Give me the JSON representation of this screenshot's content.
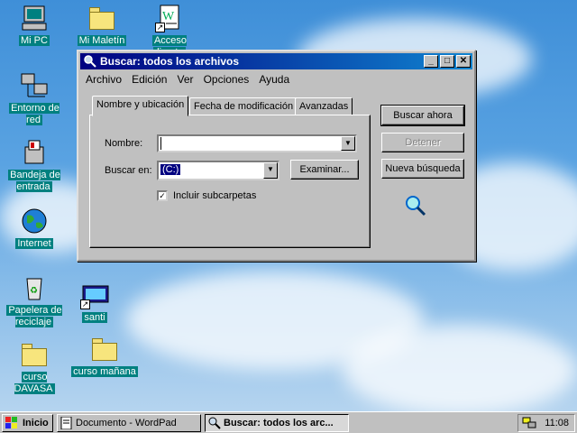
{
  "desktop": {
    "icons": [
      {
        "label": "Mi PC",
        "icon": "computer-icon"
      },
      {
        "label": "Mi Maletín",
        "icon": "briefcase-folder-icon"
      },
      {
        "label": "Acceso directo",
        "icon": "wordpad-shortcut-icon"
      },
      {
        "label": "Entorno de red",
        "icon": "network-icon"
      },
      {
        "label": "Bandeja de entrada",
        "icon": "inbox-icon"
      },
      {
        "label": "Internet",
        "icon": "internet-globe-icon"
      },
      {
        "label": "Papelera de reciclaje",
        "icon": "recycle-bin-icon"
      },
      {
        "label": "santi",
        "icon": "calculator-shortcut-icon"
      },
      {
        "label": "curso DAVASA",
        "icon": "folder-icon"
      },
      {
        "label": "curso mañana",
        "icon": "folder-icon"
      }
    ]
  },
  "window": {
    "title": "Buscar: todos los archivos",
    "menu": [
      "Archivo",
      "Edición",
      "Ver",
      "Opciones",
      "Ayuda"
    ],
    "tabs": [
      "Nombre y ubicación",
      "Fecha de modificación",
      "Avanzadas"
    ],
    "active_tab": "Nombre y ubicación",
    "name_label": "Nombre:",
    "name_value": "",
    "search_in_label": "Buscar en:",
    "search_in_value": "(C:)",
    "browse_button": "Examinar...",
    "subfolders_label": "Incluir subcarpetas",
    "subfolders_checked": true,
    "search_now_button": "Buscar ahora",
    "stop_button": "Detener",
    "new_search_button": "Nueva búsqueda"
  },
  "taskbar": {
    "start_label": "Inicio",
    "tasks": [
      {
        "label": "Documento - WordPad",
        "active": false
      },
      {
        "label": "Buscar: todos los arc...",
        "active": true
      }
    ],
    "clock": "11:08"
  },
  "colors": {
    "desktop_label_bg": "#008080",
    "title_bar": "#000080",
    "face": "#c0c0c0"
  }
}
